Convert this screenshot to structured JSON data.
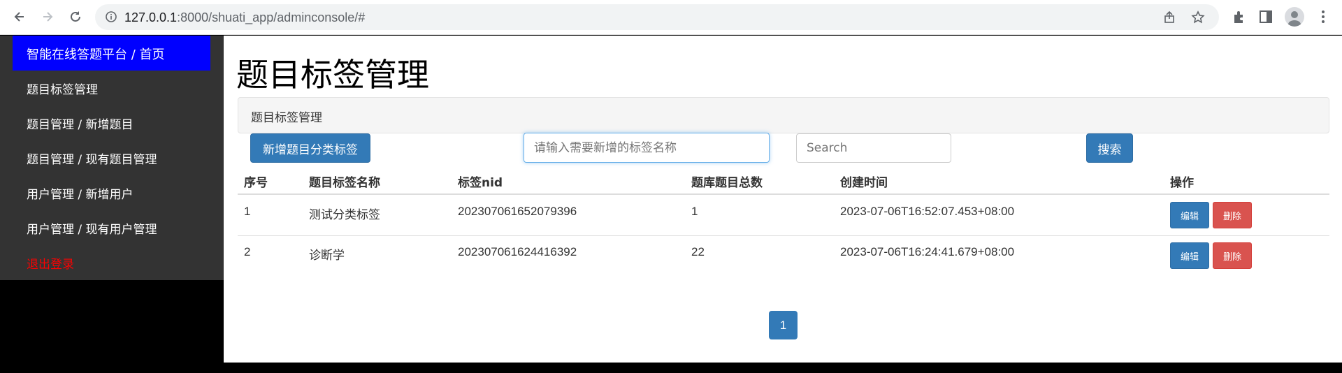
{
  "browser": {
    "url_host": "127.0.0.1",
    "url_rest": ":8000/shuati_app/adminconsole/#"
  },
  "sidebar": {
    "brand": "智能在线答题平台 / 首页",
    "items": [
      {
        "label": "题目标签管理"
      },
      {
        "label": "题目管理 / 新增题目"
      },
      {
        "label": "题目管理 / 现有题目管理"
      },
      {
        "label": "用户管理 / 新增用户"
      },
      {
        "label": "用户管理 / 现有用户管理"
      }
    ],
    "logout": "退出登录"
  },
  "main": {
    "title": "题目标签管理",
    "breadcrumb": "题目标签管理",
    "add_button": "新增题目分类标签",
    "new_tag_placeholder": "请输入需要新增的标签名称",
    "search_placeholder": "Search",
    "search_button": "搜索",
    "columns": [
      "序号",
      "题目标签名称",
      "标签nid",
      "题库题目总数",
      "创建时间",
      "操作"
    ],
    "rows": [
      {
        "index": "1",
        "name": "测试分类标签",
        "nid": "202307061652079396",
        "count": "1",
        "created": "2023-07-06T16:52:07.453+08:00",
        "edit": "编辑",
        "delete": "删除"
      },
      {
        "index": "2",
        "name": "诊断学",
        "nid": "202307061624416392",
        "count": "22",
        "created": "2023-07-06T16:24:41.679+08:00",
        "edit": "编辑",
        "delete": "删除"
      }
    ],
    "pagination": {
      "current_page": "1"
    }
  },
  "colors": {
    "sidebar_bg": "#333333",
    "brand_bg": "#0000ff",
    "logout": "#ff0000",
    "primary": "#337ab7",
    "danger": "#d9534f"
  }
}
